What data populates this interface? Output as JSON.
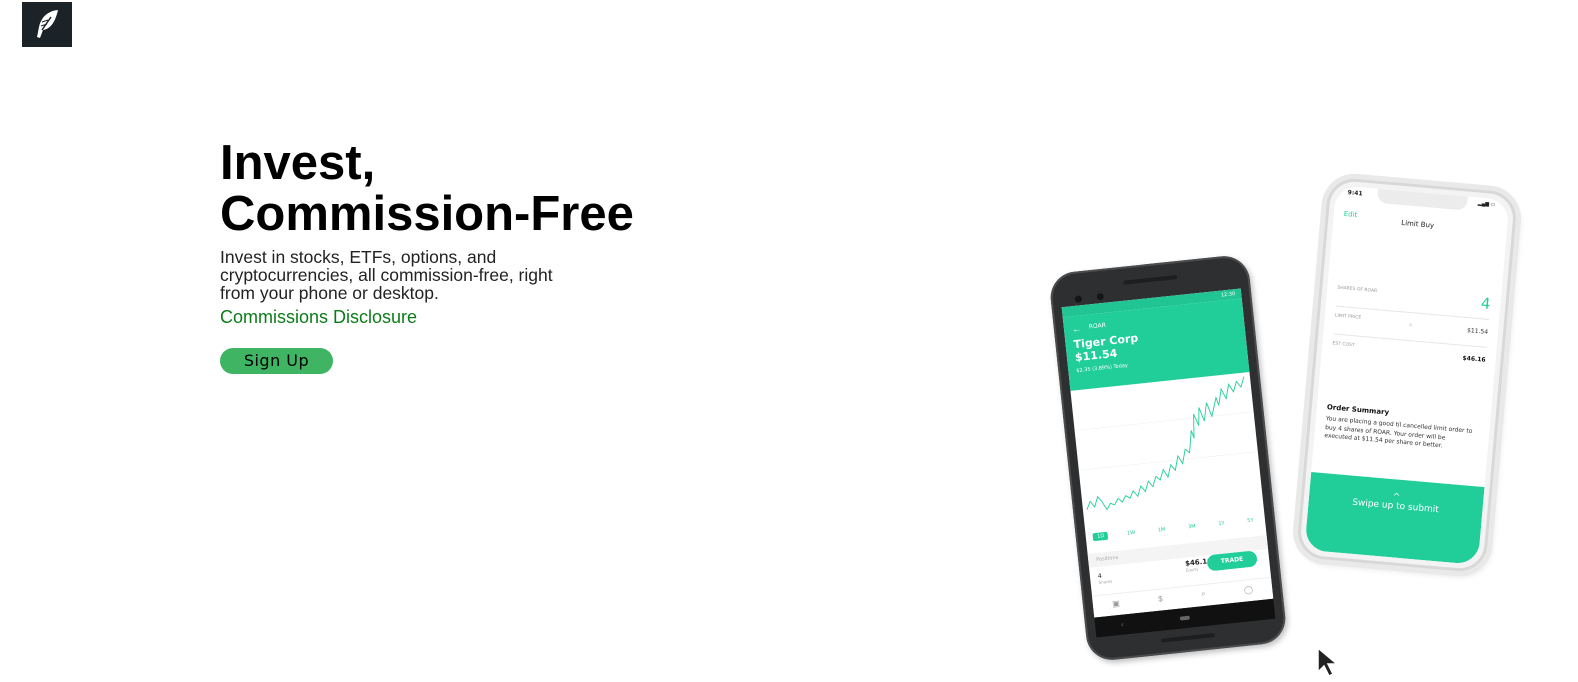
{
  "logo": {
    "icon": "feather-icon",
    "bg_color": "#1b2329"
  },
  "hero": {
    "title_line1": "Invest,",
    "title_line2": "Commission-Free",
    "subtitle": "Invest in stocks, ETFs, options, and cryptocurrencies, all commission-free, right from your phone or desktop.",
    "disclosure_link": "Commissions Disclosure",
    "signup_label": "Sign Up"
  },
  "colors": {
    "accent": "#21ce99",
    "signup_bg": "#3fb564",
    "link": "#0a7c18"
  },
  "android_phone": {
    "status_time": "12:30",
    "symbol": "ROAR",
    "company": "Tiger Corp",
    "price": "$11.54",
    "change": "$2.35 (3.89%) Today",
    "ranges": [
      "1D",
      "1W",
      "1M",
      "3M",
      "1Y",
      "5Y"
    ],
    "active_range": "1D",
    "positions_label": "Positions",
    "shares_value": "4",
    "shares_label": "Shares",
    "equity_value": "$46.16",
    "equity_label": "Equity",
    "trade_label": "TRADE",
    "nav_icons": [
      "portfolio-icon",
      "dollar-icon",
      "search-icon",
      "account-icon"
    ]
  },
  "iphone": {
    "time": "9:41",
    "edit_label": "Edit",
    "title": "Limit Buy",
    "fields": [
      {
        "label": "SHARES OF ROAR",
        "value": "4"
      },
      {
        "label": "LIMIT PRICE",
        "value": "$11.54"
      },
      {
        "label": "EST COST",
        "value": "$46.16"
      }
    ],
    "summary_title": "Order Summary",
    "summary_text": "You are placing a good til cancelled limit order to buy 4 shares of ROAR. Your order will be executed at $11.54 per share or better.",
    "submit_label": "Swipe up to submit"
  }
}
